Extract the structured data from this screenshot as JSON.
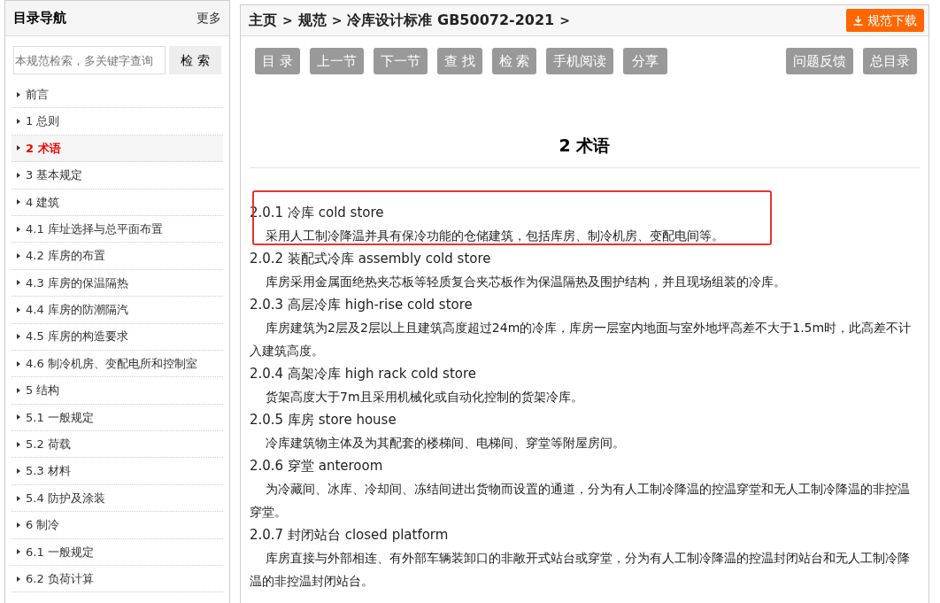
{
  "sidebar": {
    "title": "目录导航",
    "more": "更多",
    "search": {
      "placeholder": "本规范检索，多关键字查询",
      "button": "检 索"
    },
    "items": [
      {
        "label": "前言",
        "selected": false
      },
      {
        "label": "1 总则",
        "selected": false
      },
      {
        "label": "2 术语",
        "selected": true
      },
      {
        "label": "3 基本规定",
        "selected": false
      },
      {
        "label": "4 建筑",
        "selected": false
      },
      {
        "label": "4.1 库址选择与总平面布置",
        "selected": false
      },
      {
        "label": "4.2 库房的布置",
        "selected": false
      },
      {
        "label": "4.3 库房的保温隔热",
        "selected": false
      },
      {
        "label": "4.4 库房的防潮隔汽",
        "selected": false
      },
      {
        "label": "4.5 库房的构造要求",
        "selected": false
      },
      {
        "label": "4.6 制冷机房、变配电所和控制室",
        "selected": false
      },
      {
        "label": "5 结构",
        "selected": false
      },
      {
        "label": "5.1 一般规定",
        "selected": false
      },
      {
        "label": "5.2 荷载",
        "selected": false
      },
      {
        "label": "5.3 材料",
        "selected": false
      },
      {
        "label": "5.4 防护及涂装",
        "selected": false
      },
      {
        "label": "6 制冷",
        "selected": false
      },
      {
        "label": "6.1 一般规定",
        "selected": false
      },
      {
        "label": "6.2 负荷计算",
        "selected": false
      }
    ]
  },
  "breadcrumb": [
    "主页",
    "规范",
    "冷库设计标准 GB50072-2021"
  ],
  "breadcrumb_separator": ">",
  "download_button": "规范下载",
  "toolbar_left": [
    "目 录",
    "上一节",
    "下一节",
    "查 找",
    "检 索",
    "手机阅读",
    "分享"
  ],
  "toolbar_right": [
    "问题反馈",
    "总目录"
  ],
  "section_title": "2 术语",
  "terms": [
    {
      "heading": "2.0.1 冷库 cold store",
      "body": "采用人工制冷降温并具有保冷功能的仓储建筑，包括库房、制冷机房、变配电间等。",
      "highlighted": true
    },
    {
      "heading": "2.0.2 装配式冷库 assembly cold store",
      "body": "库房采用金属面绝热夹芯板等轻质复合夹芯板作为保温隔热及围护结构，并且现场组装的冷库。",
      "highlighted": false
    },
    {
      "heading": "2.0.3 高层冷库 high-rise cold store",
      "body": "库房建筑为2层及2层以上且建筑高度超过24m的冷库，库房一层室内地面与室外地坪高差不大于1.5m时，此高差不计入建筑高度。",
      "highlighted": false
    },
    {
      "heading": "2.0.4 高架冷库 high rack cold store",
      "body": "货架高度大于7m且采用机械化或自动化控制的货架冷库。",
      "highlighted": false
    },
    {
      "heading": "2.0.5 库房 store house",
      "body": "冷库建筑物主体及为其配套的楼梯间、电梯间、穿堂等附屋房间。",
      "highlighted": false
    },
    {
      "heading": "2.0.6 穿堂 anteroom",
      "body": "为冷藏间、冰库、冷却间、冻结间进出货物而设置的通道，分为有人工制冷降温的控温穿堂和无人工制冷降温的非控温穿堂。",
      "highlighted": false
    },
    {
      "heading": "2.0.7 封闭站台 closed platform",
      "body": "库房直接与外部相连、有外部车辆装卸口的非敞开式站台或穿堂，分为有人工制冷降温的控温封闭站台和无人工制冷降温的非控温封闭站台。",
      "highlighted": false
    }
  ]
}
